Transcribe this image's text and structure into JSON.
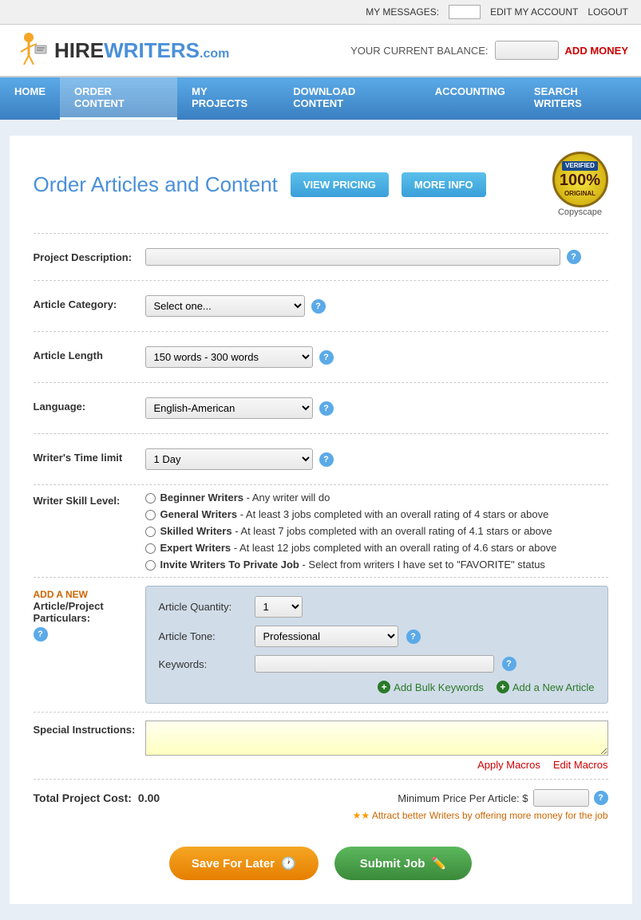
{
  "topbar": {
    "my_messages_label": "MY MESSAGES:",
    "edit_account": "EDIT MY ACCOUNT",
    "logout": "LOGOUT"
  },
  "logobar": {
    "logo_text": "HIREWRITERS",
    "logo_com": ".com",
    "balance_label": "YOUR CURRENT BALANCE:",
    "add_money": "ADD MONEY"
  },
  "nav": {
    "items": [
      {
        "label": "HOME",
        "active": false
      },
      {
        "label": "ORDER CONTENT",
        "active": true
      },
      {
        "label": "MY PROJECTS",
        "active": false
      },
      {
        "label": "DOWNLOAD CONTENT",
        "active": false
      },
      {
        "label": "ACCOUNTING",
        "active": false
      },
      {
        "label": "SEARCH WRITERS",
        "active": false
      }
    ]
  },
  "page": {
    "title": "Order Articles and Content",
    "view_pricing": "VIEW PRICING",
    "more_info": "MORE INFO",
    "badge_verified": "VERIFIED",
    "badge_original": "100%",
    "badge_sub": "ORIGINAL",
    "copyscape_label": "Copyscape"
  },
  "form": {
    "project_desc_label": "Project Description:",
    "project_desc_placeholder": "",
    "article_category_label": "Article Category:",
    "article_category_placeholder": "Select one...",
    "article_length_label": "Article Length",
    "article_length_value": "150 words - 300 words",
    "language_label": "Language:",
    "language_value": "English-American",
    "writer_time_label": "Writer's Time limit",
    "writer_time_value": "1 Day",
    "skill_level_label": "Writer Skill Level:",
    "skill_options": [
      {
        "name": "Beginner Writers",
        "desc": " - Any writer will do"
      },
      {
        "name": "General Writers",
        "desc": " - At least 3 jobs completed with an overall rating of 4 stars or above"
      },
      {
        "name": "Skilled Writers",
        "desc": " - At least 7 jobs completed with an overall rating of 4.1 stars or above"
      },
      {
        "name": "Expert Writers",
        "desc": " - At least 12 jobs completed with an overall rating of 4.6 stars or above"
      },
      {
        "name": "Invite Writers To Private Job",
        "desc": " - Select from writers I have set to \"FAVORITE\" status"
      }
    ],
    "add_new_label": "ADD A NEW",
    "add_new_sub": "Article/Project",
    "add_new_sub2": "Particulars:",
    "article_quantity_label": "Article Quantity:",
    "article_quantity_value": "1",
    "article_tone_label": "Article Tone:",
    "article_tone_value": "Professional",
    "keywords_label": "Keywords:",
    "bulk_keywords": "Add Bulk Keywords",
    "add_new_article": "Add a New Article",
    "special_instructions_label": "Special Instructions:",
    "apply_macros": "Apply Macros",
    "edit_macros": "Edit Macros",
    "total_cost_label": "Total Project Cost:",
    "total_cost_value": "0.00",
    "min_price_label": "Minimum Price Per Article: $",
    "attract_notice": "★★  Attract better Writers by offering more money for the job",
    "save_later": "Save For Later",
    "submit_job": "Submit Job"
  }
}
